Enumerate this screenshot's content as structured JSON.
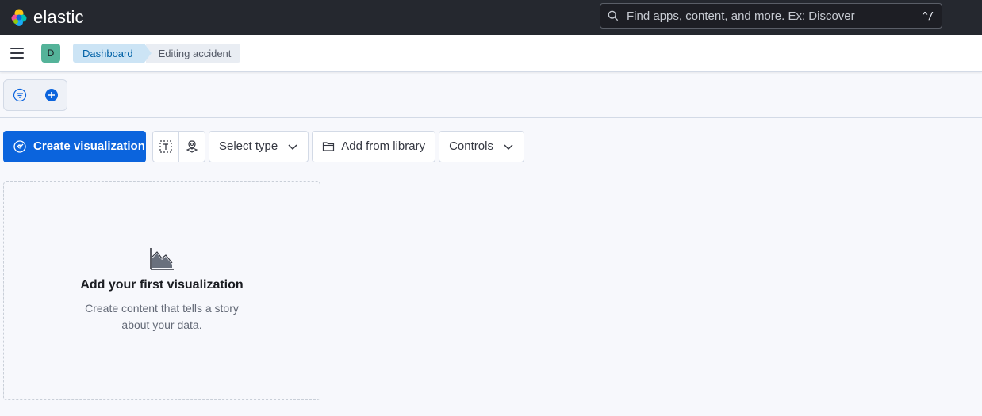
{
  "header": {
    "brand": "elastic",
    "search_placeholder": "Find apps, content, and more. Ex: Discover",
    "search_shortcut": "^/"
  },
  "nav": {
    "space_avatar": "D",
    "breadcrumbs": [
      {
        "label": "Dashboard"
      },
      {
        "label": "Editing accident"
      }
    ]
  },
  "toolbar": {
    "create_label": "Create visualization",
    "select_type_label": "Select type",
    "add_library_label": "Add from library",
    "controls_label": "Controls"
  },
  "empty_state": {
    "title": "Add your first visualization",
    "description": "Create content that tells a story about your data."
  },
  "colors": {
    "primary": "#0B64DD",
    "header_bg": "#25282F",
    "space_avatar": "#54B399"
  }
}
